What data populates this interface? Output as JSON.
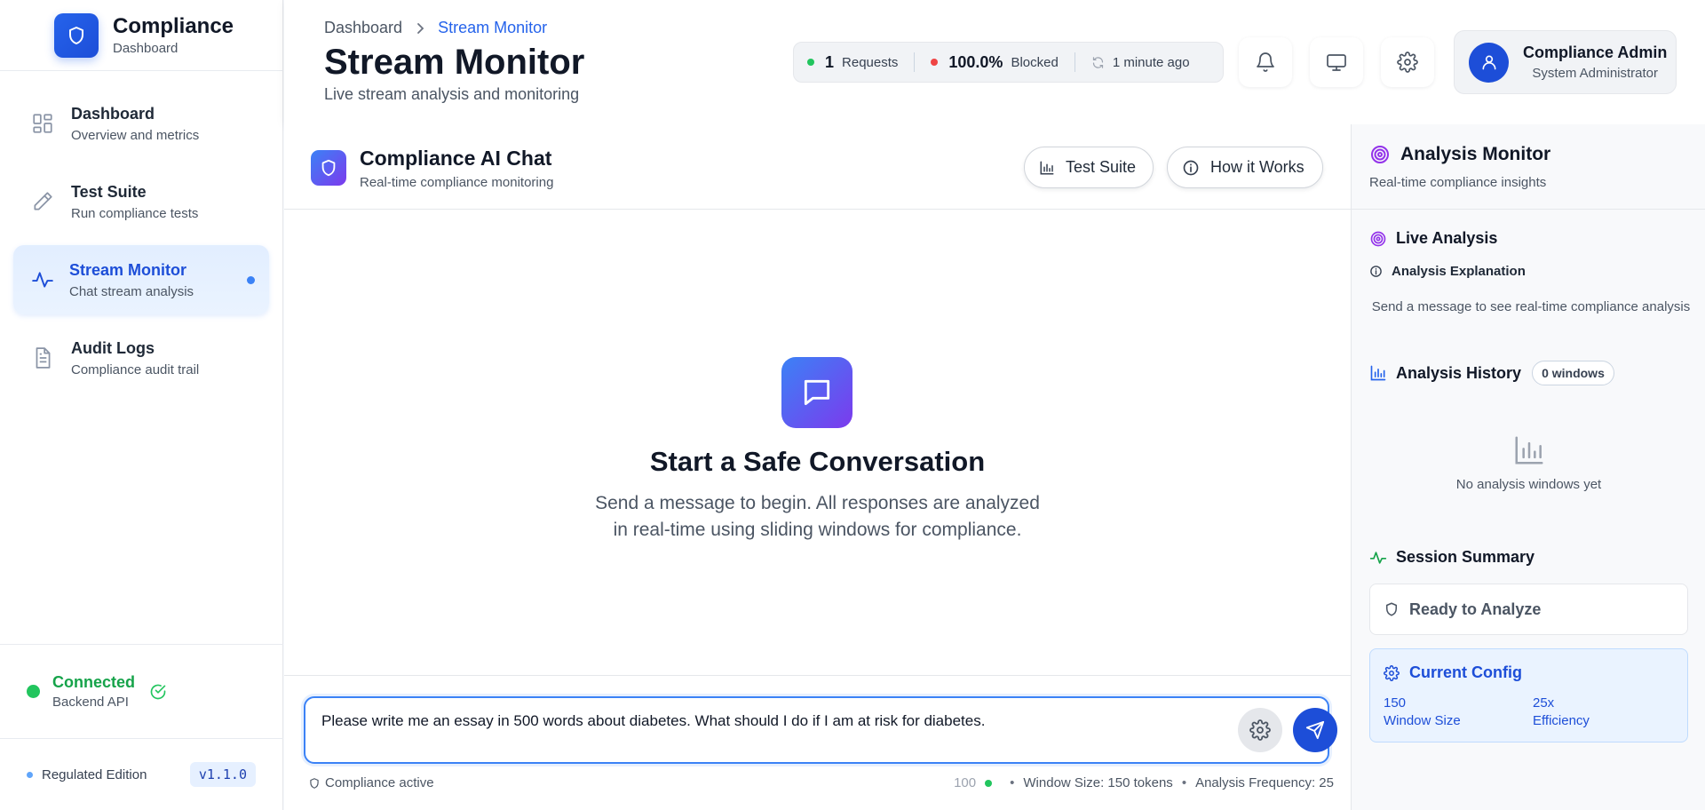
{
  "sidebar": {
    "brand": {
      "title": "Compliance",
      "subtitle": "Dashboard",
      "icon": "shield-icon"
    },
    "items": [
      {
        "label": "Dashboard",
        "desc": "Overview and metrics",
        "icon": "grid-icon"
      },
      {
        "label": "Test Suite",
        "desc": "Run compliance tests",
        "icon": "pen-icon"
      },
      {
        "label": "Stream Monitor",
        "desc": "Chat stream analysis",
        "icon": "activity-icon",
        "active": true
      },
      {
        "label": "Audit Logs",
        "desc": "Compliance audit trail",
        "icon": "file-icon"
      }
    ],
    "connection": {
      "status": "Connected",
      "target": "Backend API"
    },
    "edition": "Regulated Edition",
    "version": "v1.1.0"
  },
  "header": {
    "breadcrumb": [
      "Dashboard",
      "Stream Monitor"
    ],
    "title": "Stream Monitor",
    "subtitle": "Live stream analysis and monitoring",
    "stats": {
      "requests_value": "1",
      "requests_label": "Requests",
      "blocked_value": "100.0%",
      "blocked_label": "Blocked",
      "updated": "1 minute ago"
    },
    "user": {
      "name": "Compliance Admin",
      "role": "System Administrator"
    }
  },
  "chat": {
    "title": "Compliance AI Chat",
    "subtitle": "Real-time compliance monitoring",
    "buttons": {
      "test_suite": "Test Suite",
      "how_it_works": "How it Works"
    },
    "empty": {
      "title": "Start a Safe Conversation",
      "text": "Send a message to begin. All responses are analyzed in real-time using sliding windows for compliance."
    },
    "input": {
      "value": "Please write me an essay in 500 words about diabetes. What should I do if I am at risk for diabetes."
    },
    "footer": {
      "compliance": "Compliance active",
      "count": "100",
      "window_size": "Window Size: 150 tokens",
      "frequency": "Analysis Frequency: 25"
    }
  },
  "panel": {
    "title": "Analysis Monitor",
    "subtitle": "Real-time compliance insights",
    "live": {
      "title": "Live Analysis",
      "explanation_title": "Analysis Explanation",
      "explanation_text": "Send a message to see real-time compliance analysis"
    },
    "history": {
      "title": "Analysis History",
      "badge": "0 windows",
      "empty": "No analysis windows yet"
    },
    "session": {
      "title": "Session Summary",
      "status": "Ready to Analyze"
    },
    "config": {
      "title": "Current Config",
      "window_size_value": "150",
      "window_size_label": "Window Size",
      "efficiency_value": "25x",
      "efficiency_label": "Efficiency"
    }
  },
  "colors": {
    "accent": "#2563eb",
    "success": "#22c55e",
    "danger": "#ef4444",
    "purple": "#7c3aed"
  }
}
